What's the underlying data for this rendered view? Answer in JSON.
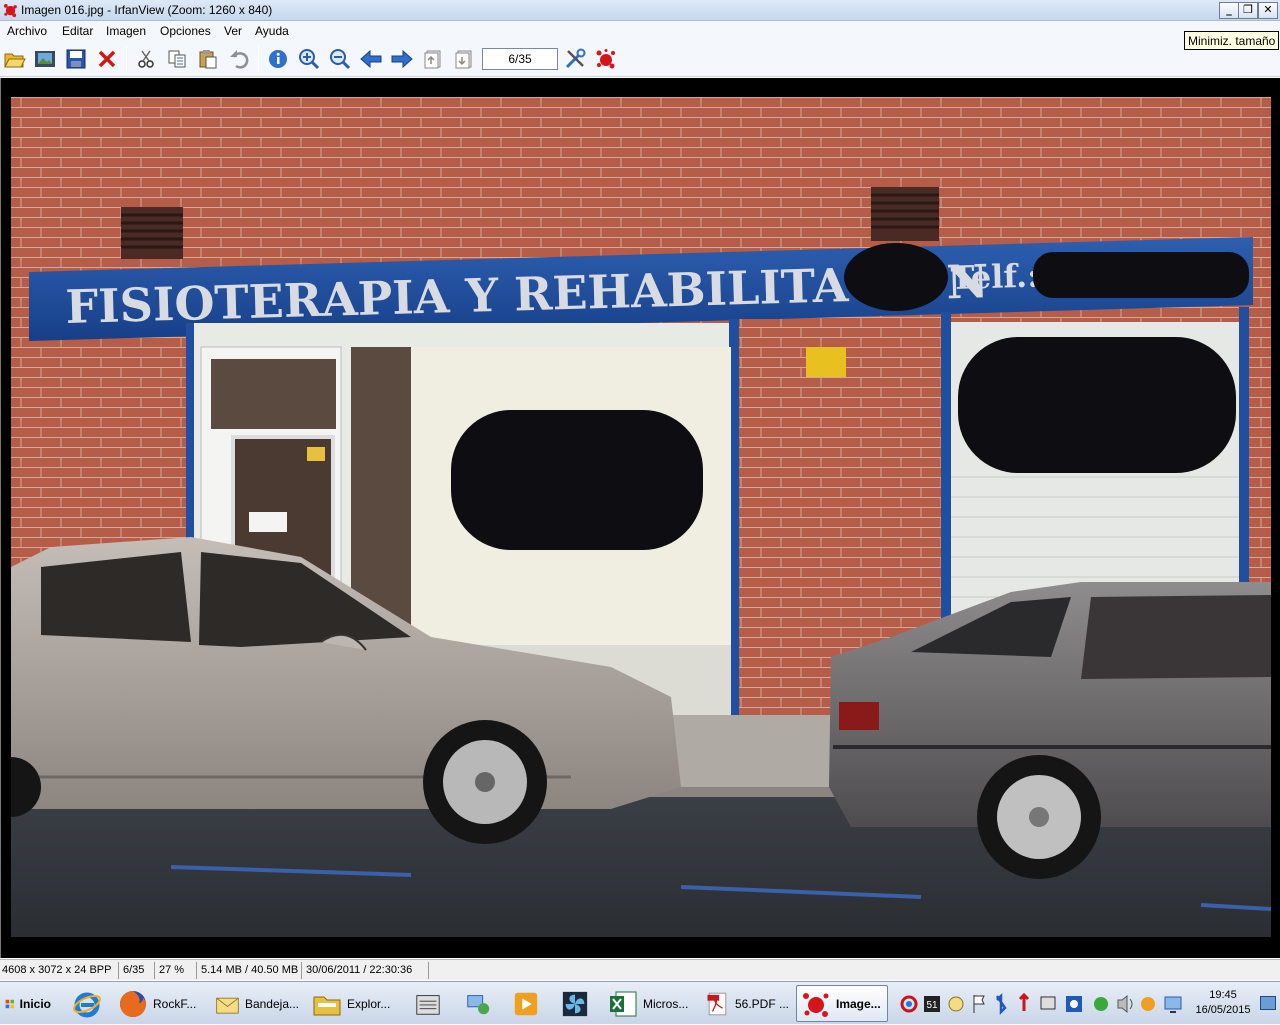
{
  "window": {
    "title": "Imagen 016.jpg - IrfanView (Zoom: 1260 x 840)",
    "minimize": "_",
    "restore": "❐",
    "close": "✕"
  },
  "menu": [
    "Archivo",
    "Editar",
    "Imagen",
    "Opciones",
    "Ver",
    "Ayuda"
  ],
  "toolbar": {
    "page_indicator": "6/35",
    "icons": [
      "open-folder-icon",
      "slideshow-icon",
      "save-icon",
      "delete-icon",
      "cut-icon",
      "copy-icon",
      "paste-icon",
      "undo-icon",
      "info-icon",
      "zoom-in-icon",
      "zoom-out-icon",
      "previous-icon",
      "next-icon",
      "first-page-icon",
      "next-page-icon",
      "settings-icon",
      "irfanview-logo-icon"
    ]
  },
  "tooltip": "Minimiz. tamaño",
  "photo": {
    "sign_text": "FISIOTERAPIA Y REHABILITACIÓN",
    "phone_label": "Telf.:"
  },
  "status": {
    "dimensions": "4608 x 3072 x 24 BPP",
    "index": "6/35",
    "zoom": "27 %",
    "filesize": "5.14 MB / 40.50 MB",
    "datetime": "30/06/2011 / 22:30:36"
  },
  "taskbar": {
    "start": "Inicio",
    "buttons": [
      {
        "label": "RockF...",
        "icon": "firefox-icon"
      },
      {
        "label": "Bandeja...",
        "icon": "mail-icon"
      },
      {
        "label": "Explor...",
        "icon": "folder-icon"
      },
      {
        "label": "Micros...",
        "icon": "excel-icon"
      },
      {
        "label": "56.PDF ...",
        "icon": "pdf-icon"
      },
      {
        "label": "Image...",
        "icon": "irfanview-icon"
      }
    ],
    "tray_badge": "51",
    "clock_time": "19:45",
    "clock_date": "16/05/2015"
  },
  "colors": {
    "sign_blue": "#1f4f9e",
    "brick": "#b15d4a",
    "accent_red": "#cc1d1d"
  }
}
